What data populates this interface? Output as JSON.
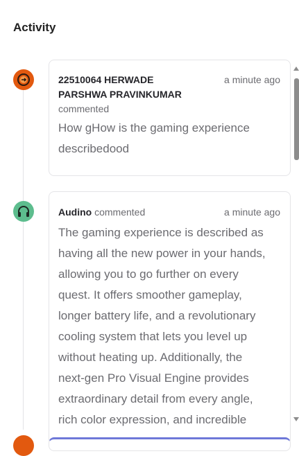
{
  "header": {
    "title": "Activity"
  },
  "activities": [
    {
      "author_line1": "22510064 HERWADE",
      "author_line2": "PARSHWA PRAVINKUMAR",
      "action": "commented",
      "time": "a minute ago",
      "text_line1": "How gHow is the gaming experience",
      "text_line2": "describedood",
      "avatar_icon": "gamepad-icon",
      "avatar_color": "#e2590f"
    },
    {
      "author": "Audino",
      "action": "commented",
      "time": "a minute ago",
      "lines": [
        "The gaming experience is described as",
        "having all the new power in your hands,",
        "allowing you to go further on every",
        "quest. It offers smoother gameplay,",
        "longer battery life, and a revolutionary",
        "cooling system that lets you level up",
        "without heating up. Additionally, the",
        "next-gen Pro Visual Engine provides",
        "extraordinary detail from every angle,",
        "rich color expression, and incredible"
      ],
      "avatar_icon": "headphones-icon",
      "avatar_color": "#5dbd8e"
    }
  ]
}
